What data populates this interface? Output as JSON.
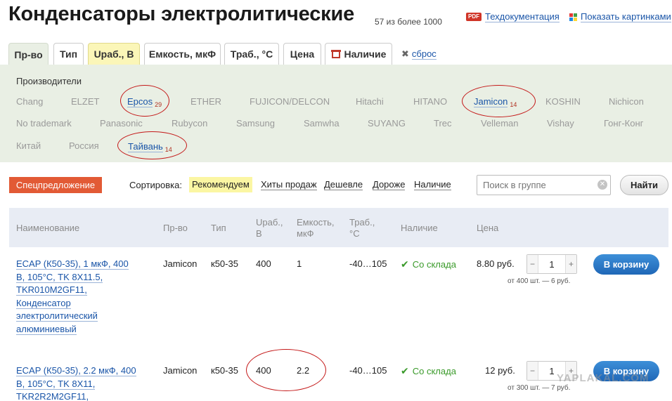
{
  "header": {
    "title": "Конденсаторы электролитические",
    "count": "57 из более 1000",
    "docs_icon": "PDF",
    "docs_label": "Техдокументация",
    "images_label": "Показать картинками",
    "images_icon_colors": [
      "#e53935",
      "#43a047",
      "#1e88e5",
      "#fdd835"
    ]
  },
  "tabs": [
    {
      "label": "Пр-во",
      "state": "active"
    },
    {
      "label": "Тип",
      "state": "normal"
    },
    {
      "label": "Uраб., В",
      "state": "highlighted"
    },
    {
      "label": "Емкость, мкФ",
      "state": "normal"
    },
    {
      "label": "Траб., °C",
      "state": "normal"
    },
    {
      "label": "Цена",
      "state": "normal"
    },
    {
      "label": "Наличие",
      "state": "normal",
      "icon": "shop-icon"
    }
  ],
  "reset_label": "сброс",
  "manufacturers": {
    "title": "Производители",
    "items": [
      {
        "name": "Chang",
        "count": "",
        "active": false
      },
      {
        "name": "ELZET",
        "count": "",
        "active": false
      },
      {
        "name": "Epcos",
        "count": "29",
        "active": true
      },
      {
        "name": "ETHER",
        "count": "",
        "active": false
      },
      {
        "name": "FUJICON/DELCON",
        "count": "",
        "active": false
      },
      {
        "name": "Hitachi",
        "count": "",
        "active": false
      },
      {
        "name": "HITANO",
        "count": "",
        "active": false
      },
      {
        "name": "Jamicon",
        "count": "14",
        "active": true
      },
      {
        "name": "KOSHIN",
        "count": "",
        "active": false
      },
      {
        "name": "Nichicon",
        "count": "",
        "active": false
      },
      {
        "name": "No trademark",
        "count": "",
        "active": false
      },
      {
        "name": "Panasonic",
        "count": "",
        "active": false
      },
      {
        "name": "Rubycon",
        "count": "",
        "active": false
      },
      {
        "name": "Samsung",
        "count": "",
        "active": false
      },
      {
        "name": "Samwha",
        "count": "",
        "active": false
      },
      {
        "name": "SUYANG",
        "count": "",
        "active": false
      },
      {
        "name": "Trec",
        "count": "",
        "active": false
      },
      {
        "name": "Velleman",
        "count": "",
        "active": false
      },
      {
        "name": "Vishay",
        "count": "",
        "active": false
      },
      {
        "name": "Гонг-Конг",
        "count": "",
        "active": false
      },
      {
        "name": "Китай",
        "count": "",
        "active": false
      },
      {
        "name": "Россия",
        "count": "",
        "active": false
      },
      {
        "name": "Тайвань",
        "count": "14",
        "active": true
      }
    ]
  },
  "toolbar": {
    "special_label": "Спецпредложение",
    "sort_label": "Сортировка:",
    "sort_options": [
      {
        "label": "Рекомендуем",
        "selected": true
      },
      {
        "label": "Хиты продаж",
        "selected": false
      },
      {
        "label": "Дешевле",
        "selected": false
      },
      {
        "label": "Дороже",
        "selected": false
      },
      {
        "label": "Наличие",
        "selected": false
      }
    ],
    "search_placeholder": "Поиск в группе",
    "find_label": "Найти"
  },
  "table": {
    "headers": {
      "name": "Наименование",
      "mfr": "Пр-во",
      "type": "Тип",
      "voltage_l1": "Uраб.,",
      "voltage_l2": "В",
      "cap_l1": "Емкость,",
      "cap_l2": "мкФ",
      "temp_l1": "Траб.,",
      "temp_l2": "°C",
      "stock": "Наличие",
      "price": "Цена"
    },
    "rows": [
      {
        "name_lines": [
          "ECAP (К50-35), 1 мкФ, 400",
          "В, 105°C, TK 8X11.5,",
          "TKR010M2GF11,",
          "Конденсатор",
          "электролитический",
          "алюминиевый"
        ],
        "mfr": "Jamicon",
        "type": "к50-35",
        "voltage": "400",
        "capacitance": "1",
        "temp": "-40…105",
        "stock": "Со склада",
        "price": "8.80 руб.",
        "qty": "1",
        "bulk": "от 400 шт. — 6 руб.",
        "cart_label": "В корзину"
      },
      {
        "name_lines": [
          "ECAP (К50-35), 2.2 мкФ, 400",
          "В, 105°C, TK 8X11,",
          "TKR2R2M2GF11,"
        ],
        "mfr": "Jamicon",
        "type": "к50-35",
        "voltage": "400",
        "capacitance": "2.2",
        "temp": "-40…105",
        "stock": "Со склада",
        "price": "12 руб.",
        "qty": "1",
        "bulk": "от 300 шт. — 7 руб.",
        "cart_label": "В корзину"
      }
    ]
  },
  "watermark": "YAPLAKAL.COM",
  "colors": {
    "link": "#1a55a8",
    "annotation": "#c41818",
    "special": "#e25a35",
    "stock": "#3a9a2a",
    "cart": "#2a78c8",
    "filter_bg": "#e9efe4",
    "header_bg": "#e8ecf4"
  }
}
